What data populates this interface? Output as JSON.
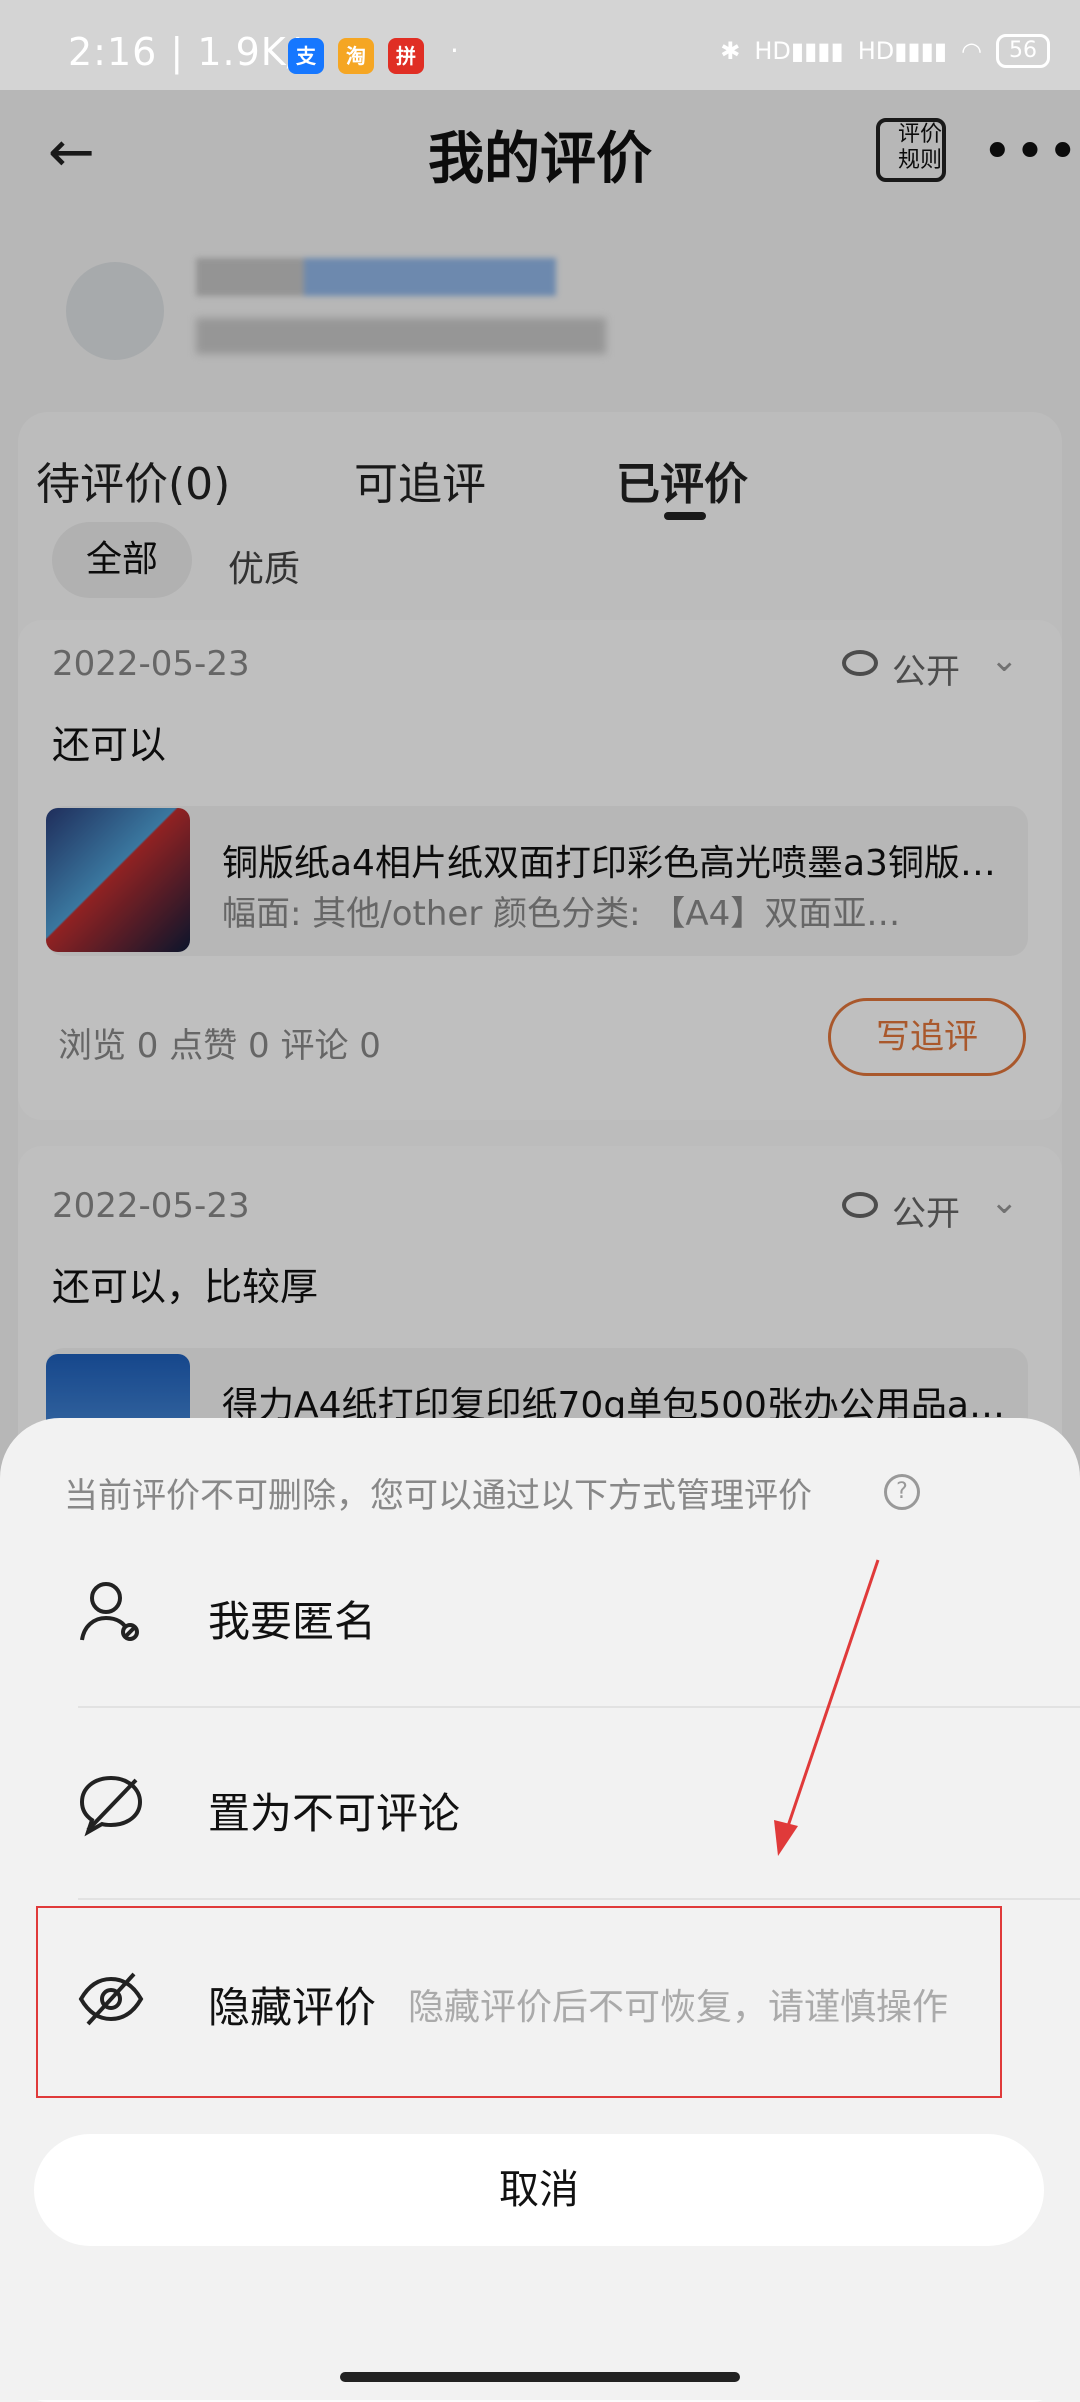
{
  "status_bar": {
    "time": "2:16",
    "net_speed": "1.9K/s",
    "app_icons": [
      "alipay-icon",
      "taobao-icon",
      "pdd-icon"
    ],
    "dot": "·",
    "signal_labels": [
      "HD",
      "HD"
    ],
    "battery": "56"
  },
  "header": {
    "title": "我的评价",
    "rules_label": "评价规则"
  },
  "tabs": [
    {
      "label": "待评价(0)"
    },
    {
      "label": "可追评"
    },
    {
      "label": "已评价",
      "active": true
    }
  ],
  "filters": {
    "all": "全部",
    "quality": "优质"
  },
  "reviews": [
    {
      "date": "2022-05-23",
      "visibility": "公开",
      "text": "还可以",
      "product_title": "铜版纸a4相片纸双面打印彩色高光喷墨a3铜版…",
      "product_spec": "幅面: 其他/other  颜色分类: 【A4】双面亚…",
      "stats": "浏览 0   点赞 0   评论 0",
      "follow_up_label": "写追评"
    },
    {
      "date": "2022-05-23",
      "visibility": "公开",
      "text": "还可以，比较厚",
      "product_title": "得力A4纸打印复印纸70g单包500张办公用品a…"
    }
  ],
  "sheet": {
    "notice": "当前评价不可删除，您可以通过以下方式管理评价",
    "options": [
      {
        "label": "我要匿名",
        "icon": "user-anonymous-icon"
      },
      {
        "label": "置为不可评论",
        "icon": "comment-off-icon"
      },
      {
        "label": "隐藏评价",
        "icon": "eye-off-icon",
        "hint": "隐藏评价后不可恢复，请谨慎操作"
      }
    ],
    "cancel_label": "取消"
  },
  "colors": {
    "accent": "#e2763b",
    "highlight": "#e03a3a"
  }
}
